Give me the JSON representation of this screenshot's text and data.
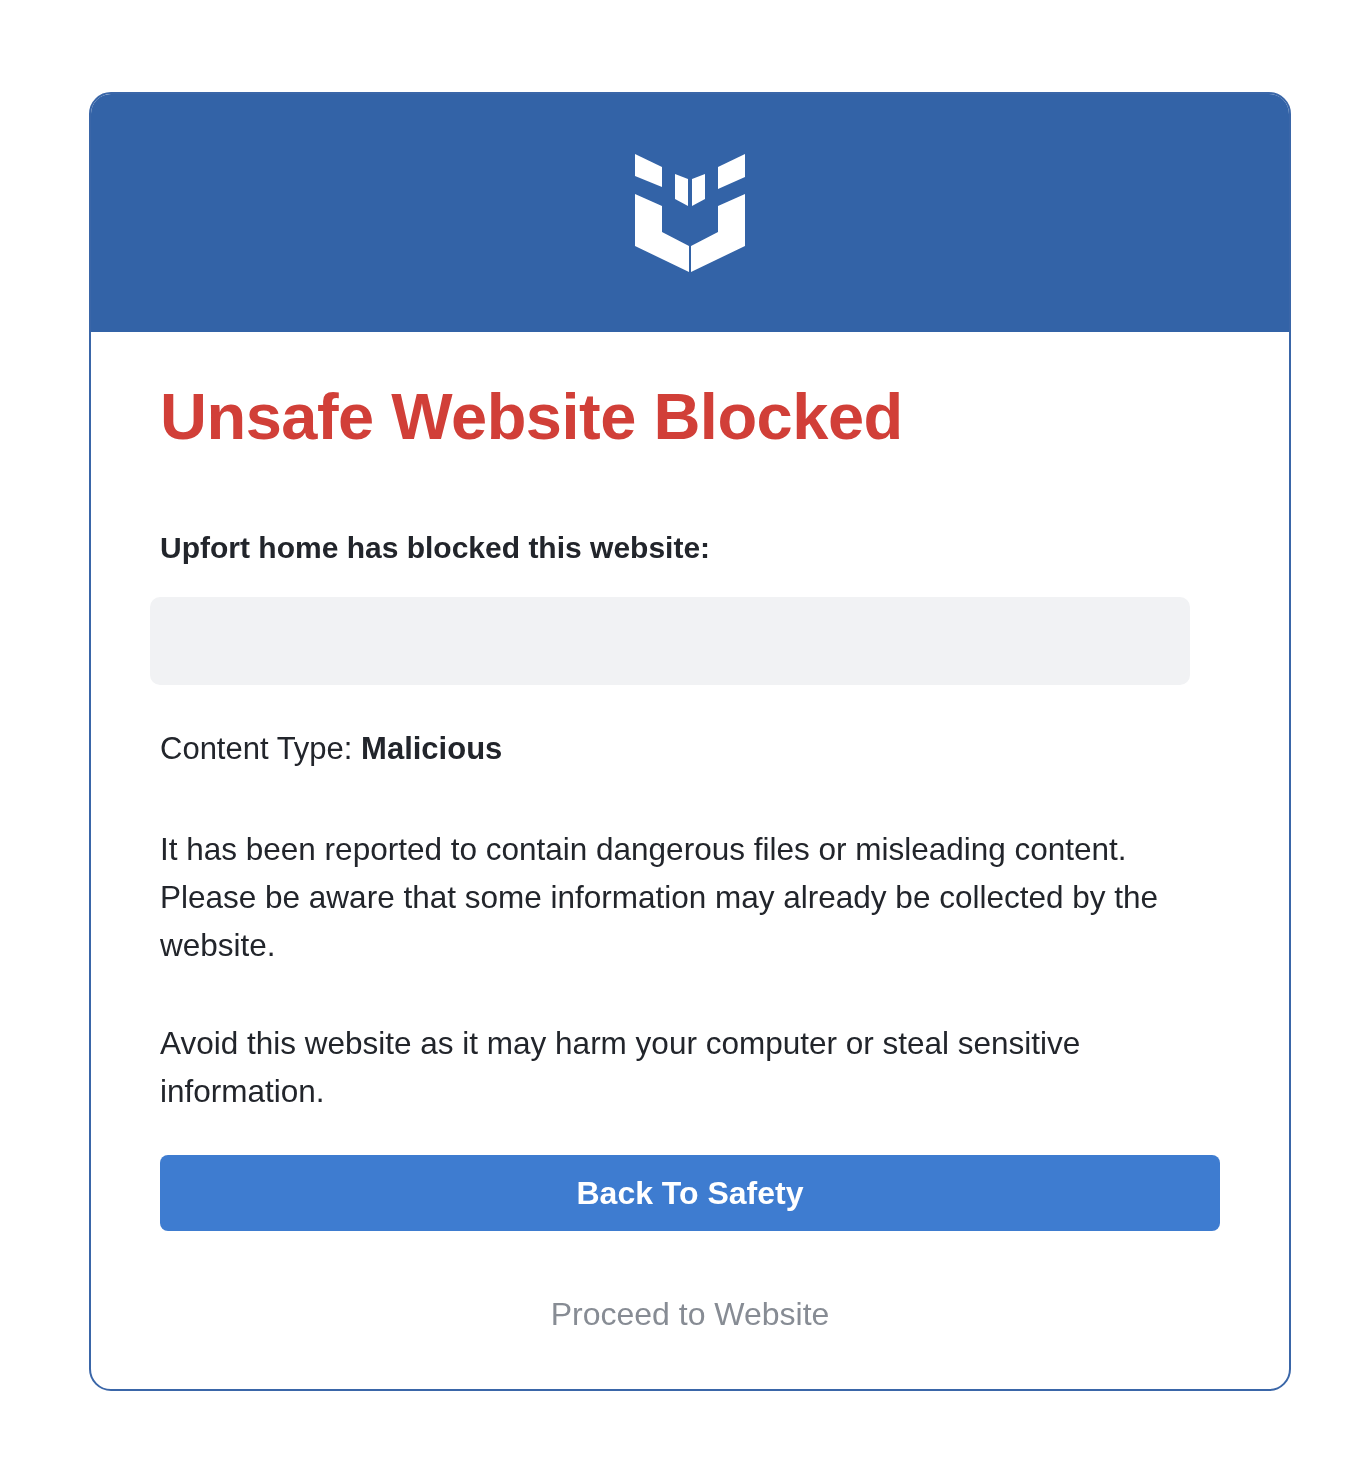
{
  "title": "Unsafe Website Blocked",
  "blocked_notice": "Upfort home has blocked this website:",
  "content_type": "Content Type: **Malicious**",
  "paragraphs": [
    "It has been reported to contain dangerous files or misleading content. Please be aware that some information may already be collected by the website.",
    "Avoid this website as it may harm your computer or steal sensitive information."
  ],
  "primary_button": "Back To Safety",
  "secondary_link": "Proceed to Website"
}
